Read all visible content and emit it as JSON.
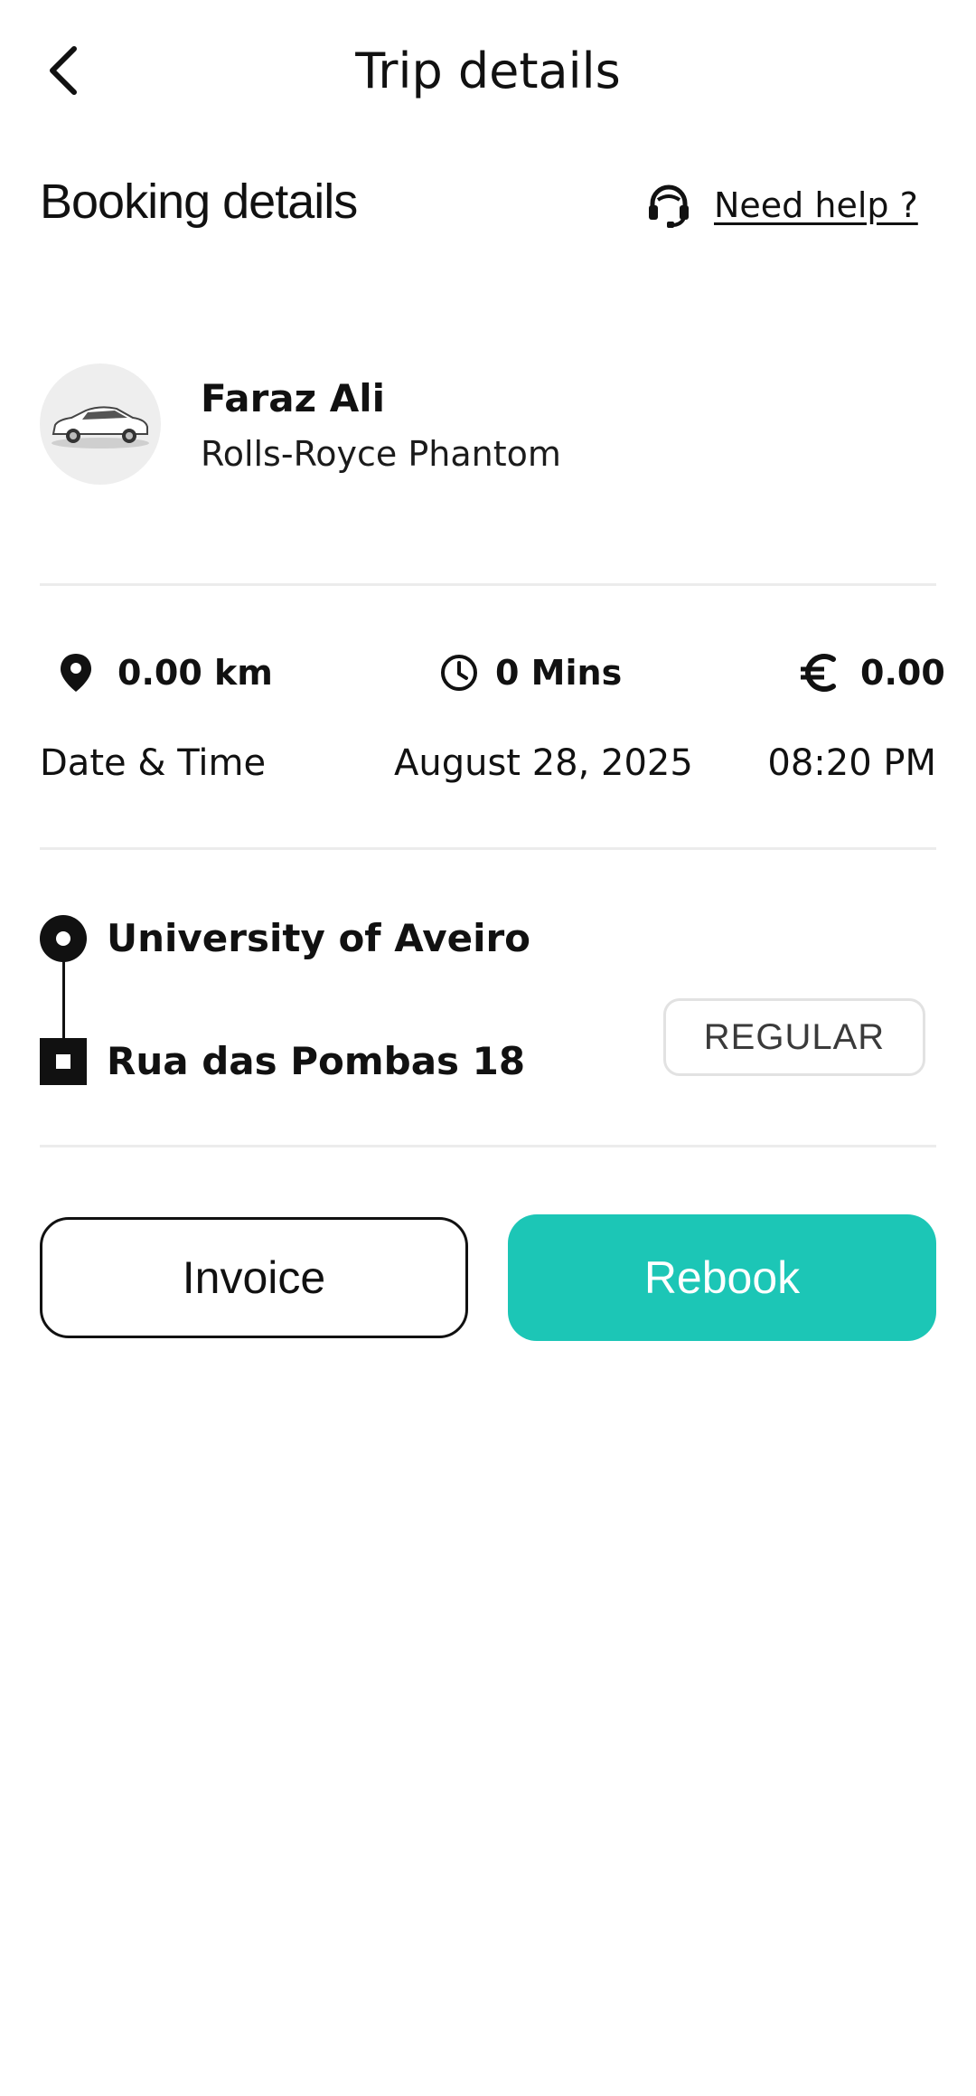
{
  "header": {
    "title": "Trip details",
    "back_icon": "chevron-left-icon"
  },
  "booking": {
    "section_title": "Booking details",
    "help_label": "Need help ?",
    "help_icon": "headset-icon"
  },
  "driver": {
    "name": "Faraz Ali",
    "car_model": "Rolls-Royce Phantom",
    "avatar_icon": "car-icon"
  },
  "stats": {
    "distance": "0.00 km",
    "duration": "0 Mins",
    "fare": "0.00",
    "distance_icon": "location-pin-icon",
    "duration_icon": "clock-icon",
    "fare_icon": "euro-icon"
  },
  "datetime": {
    "label": "Date & Time",
    "date": "August 28, 2025",
    "time": "08:20 PM"
  },
  "route": {
    "origin": "University of Aveiro",
    "destination": "Rua das Pombas 18",
    "ride_type": "REGULAR"
  },
  "actions": {
    "invoice_label": "Invoice",
    "rebook_label": "Rebook"
  },
  "colors": {
    "accent": "#1cc6b6",
    "text": "#111111",
    "divider": "#ececec"
  }
}
